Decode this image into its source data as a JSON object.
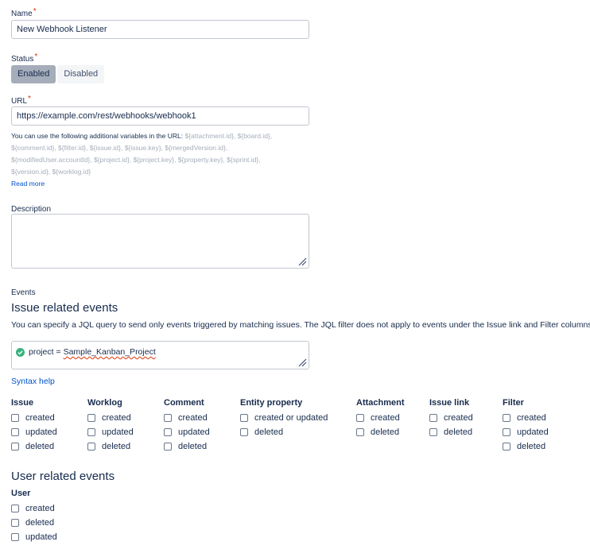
{
  "name_field": {
    "label": "Name",
    "required_mark": "*",
    "value": "New Webhook Listener"
  },
  "status_field": {
    "label": "Status",
    "required_mark": "*",
    "options": [
      "Enabled",
      "Disabled"
    ],
    "selected": "Enabled"
  },
  "url_field": {
    "label": "URL",
    "required_mark": "*",
    "value": "https://example.com/rest/webhooks/webhook1",
    "help_prefix": "You can use the following additional variables in the URL:",
    "help_variables": "${attachment.id}, ${board.id}, ${comment.id}, ${filter.id}, ${issue.id}, ${issue.key}, ${mergedVersion.id}, ${modifiedUser.accountId}, ${project.id}, ${project.key}, ${property.key}, ${sprint.id}, ${version.id}, ${worklog.id}",
    "read_more": "Read more"
  },
  "description_field": {
    "label": "Description",
    "value": ""
  },
  "events": {
    "label": "Events",
    "issue_heading": "Issue related events",
    "issue_description": "You can specify a JQL query to send only events triggered by matching issues. The JQL filter does not apply to events under the Issue link and Filter columns.",
    "jql_prefix": "project = ",
    "jql_value": "Sample_Kanban_Project",
    "syntax_help": "Syntax help",
    "columns": [
      {
        "title": "Issue",
        "items": [
          "created",
          "updated",
          "deleted"
        ]
      },
      {
        "title": "Worklog",
        "items": [
          "created",
          "updated",
          "deleted"
        ]
      },
      {
        "title": "Comment",
        "items": [
          "created",
          "updated",
          "deleted"
        ]
      },
      {
        "title": "Entity property",
        "items": [
          "created or updated",
          "deleted"
        ]
      },
      {
        "title": "Attachment",
        "items": [
          "created",
          "deleted"
        ]
      },
      {
        "title": "Issue link",
        "items": [
          "created",
          "deleted"
        ]
      },
      {
        "title": "Filter",
        "items": [
          "created",
          "updated",
          "deleted"
        ]
      }
    ],
    "user_heading": "User related events",
    "user_column": {
      "title": "User",
      "items": [
        "created",
        "deleted",
        "updated"
      ]
    }
  },
  "colors": {
    "required": "#de350b",
    "link": "#0052cc",
    "valid": "#36b37e",
    "selected_bg": "#a5adba"
  },
  "icons": {
    "jql_status": "check-circle-icon",
    "resize": "resize-grip-icon"
  }
}
